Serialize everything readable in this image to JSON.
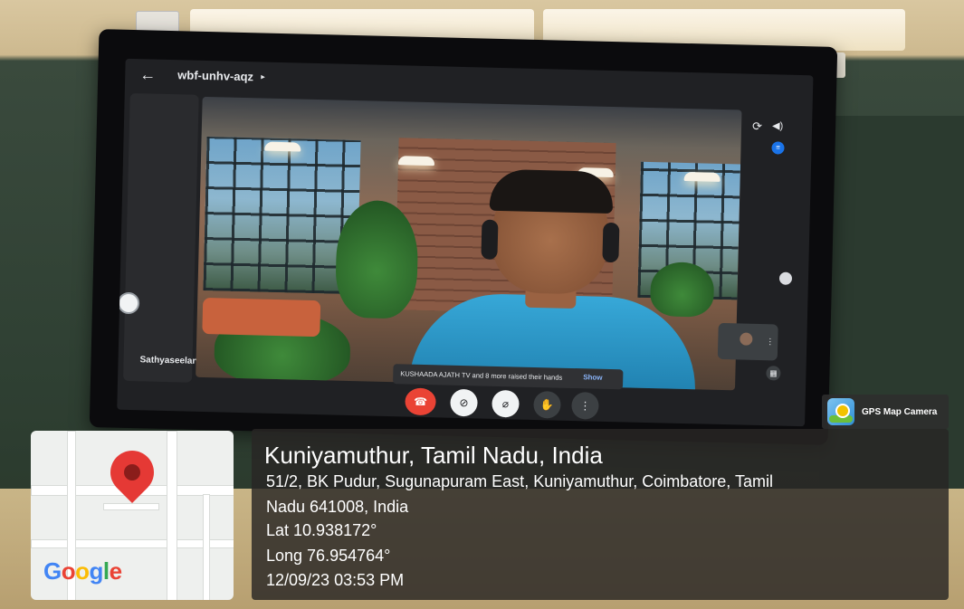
{
  "meet": {
    "back_icon": "arrow-left-icon",
    "meeting_code": "wbf-unhv-aqz",
    "code_caret": "▸",
    "left_participant_name": "Sathyaseelan",
    "raised_hands_text": "KUSHAADA AJATH TV and 8 more raised their hands",
    "raised_hands_action": "Show",
    "controls": {
      "end_call_icon": "phone-hangup-icon",
      "camera_icon": "camera-off-icon",
      "mic_icon": "mic-off-icon",
      "hand_icon": "raise-hand-icon",
      "more_icon": "more-vert-icon"
    }
  },
  "gps": {
    "badge_label": "GPS Map Camera",
    "title": "Kuniyamuthur, Tamil Nadu, India",
    "address_line1": "51/2, BK Pudur, Sugunapuram East, Kuniyamuthur, Coimbatore, Tamil",
    "address_line2": "Nadu 641008, India",
    "lat": "Lat 10.938172°",
    "long": "Long 76.954764°",
    "datetime": "12/09/23 03:53 PM",
    "map_brand": "Google"
  },
  "colors": {
    "end_call": "#ea4335",
    "meet_bg": "#202124",
    "show_link": "#8ab4f8",
    "pin": "#e53935"
  }
}
